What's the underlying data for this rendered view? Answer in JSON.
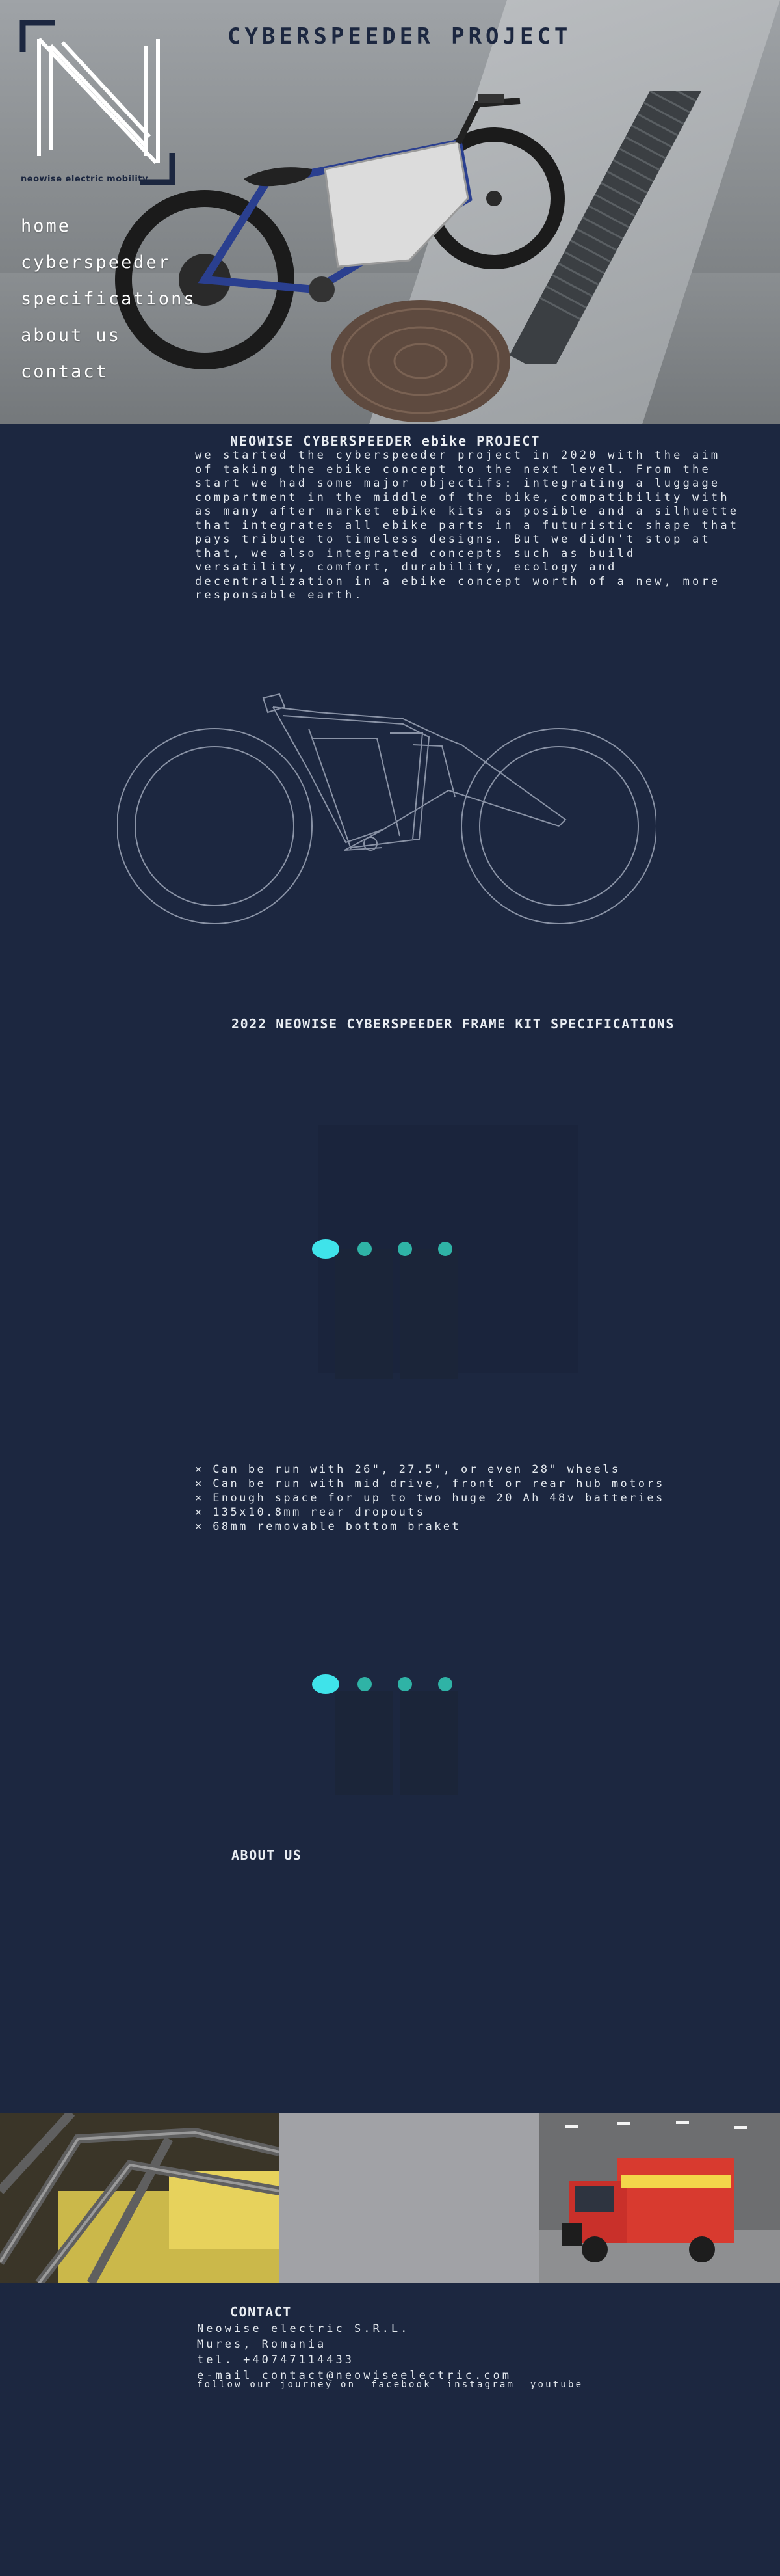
{
  "site": {
    "title": "CYBERSPEEDER PROJECT",
    "logo_text": "neowise electric mobility"
  },
  "nav": {
    "items": [
      {
        "label": "home"
      },
      {
        "label": "cyberspeeder"
      },
      {
        "label": "specifications"
      },
      {
        "label": "about us"
      },
      {
        "label": "contact"
      }
    ]
  },
  "intro": {
    "title": "NEOWISE CYBERSPEEDER ebike PROJECT",
    "text": "we started the cyberspeeder project in 2020 with the aim of taking the ebike concept to the next level. From the start we had some major objectifs: integrating a luggage compartment in the middle of the bike, compatibility with as many after market ebike kits as posible and a silhuette that integrates all ebike parts in a futuristic shape that pays tribute to timeless designs. But we didn't stop at that, we also integrated concepts such as build versatility, comfort, durability, ecology and decentralization in a ebike concept worth of a new, more responsable earth."
  },
  "specs": {
    "title": "2022 NEOWISE CYBERSPEEDER FRAME KIT SPECIFICATIONS",
    "items": [
      "Can be run with 26\", 27.5\", or even 28\" wheels",
      "Can be run with mid drive, front or rear hub motors",
      "Enough space for up to two huge 20 Ah 48v batteries",
      "135x10.8mm rear dropouts",
      "68mm removable bottom braket"
    ]
  },
  "sliders": {
    "active_color": "#3fe3ea",
    "inactive_color": "#2fb3a6",
    "slider1": {
      "active_index": 0,
      "count": 4
    },
    "slider2": {
      "active_index": 0,
      "count": 4
    }
  },
  "about": {
    "title": "ABOUT US"
  },
  "contact": {
    "title": "CONTACT",
    "company": "Neowise electric S.R.L.",
    "location": "Mures, Romania",
    "tel": "tel. +40747114433",
    "email": "e-mail contact@neowiseelectric.com",
    "follow_label": "follow our journey on",
    "social": [
      "facebook",
      "instagram",
      "youtube"
    ]
  },
  "colors": {
    "background": "#1c2740",
    "text": "#e9edf2",
    "logo": "#1c2740"
  }
}
